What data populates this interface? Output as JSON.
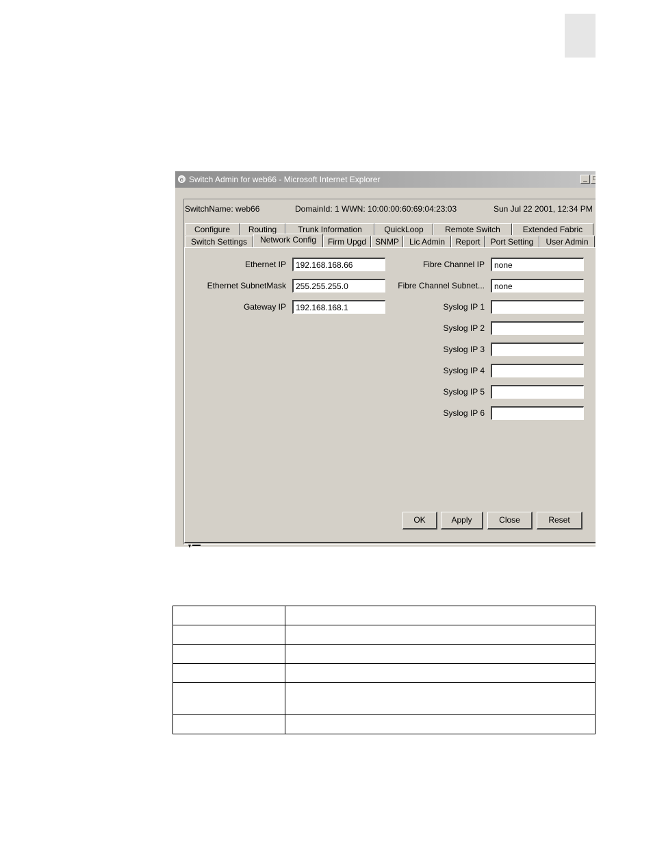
{
  "window": {
    "title": "Switch Admin for web66 - Microsoft Internet Explorer",
    "minimize_glyph": "_",
    "maximize_glyph": "□"
  },
  "status": {
    "switch_name": "SwitchName: web66",
    "domain_wwn": "DomainId: 1  WWN: 10:00:00:60:69:04:23:03",
    "datetime": "Sun Jul 22  2001, 12:34 PM"
  },
  "tabs": {
    "back_row": [
      "Configure",
      "Routing",
      "Trunk Information",
      "QuickLoop",
      "Remote Switch",
      "Extended Fabric"
    ],
    "front_row": [
      "Switch Settings",
      "Network Config",
      "Firm Upgd",
      "SNMP",
      "Lic Admin",
      "Report",
      "Port Setting",
      "User Admin"
    ],
    "active": "Network Config"
  },
  "left_fields": [
    {
      "label": "Ethernet IP",
      "value": "192.168.168.66"
    },
    {
      "label": "Ethernet SubnetMask",
      "value": "255.255.255.0"
    },
    {
      "label": "Gateway IP",
      "value": "192.168.168.1"
    }
  ],
  "right_fields": [
    {
      "label": "Fibre Channel IP",
      "value": "none"
    },
    {
      "label": "Fibre Channel Subnet...",
      "value": "none"
    },
    {
      "label": "Syslog IP 1",
      "value": ""
    },
    {
      "label": "Syslog IP 2",
      "value": ""
    },
    {
      "label": "Syslog IP 3",
      "value": ""
    },
    {
      "label": "Syslog IP 4",
      "value": ""
    },
    {
      "label": "Syslog IP 5",
      "value": ""
    },
    {
      "label": "Syslog IP 6",
      "value": ""
    }
  ],
  "buttons": {
    "ok": "OK",
    "apply": "Apply",
    "close": "Close",
    "reset": "Reset"
  },
  "colors": {
    "dialog_bg": "#d4d0c8",
    "titlebar_inactive": "#8e8e8e"
  }
}
